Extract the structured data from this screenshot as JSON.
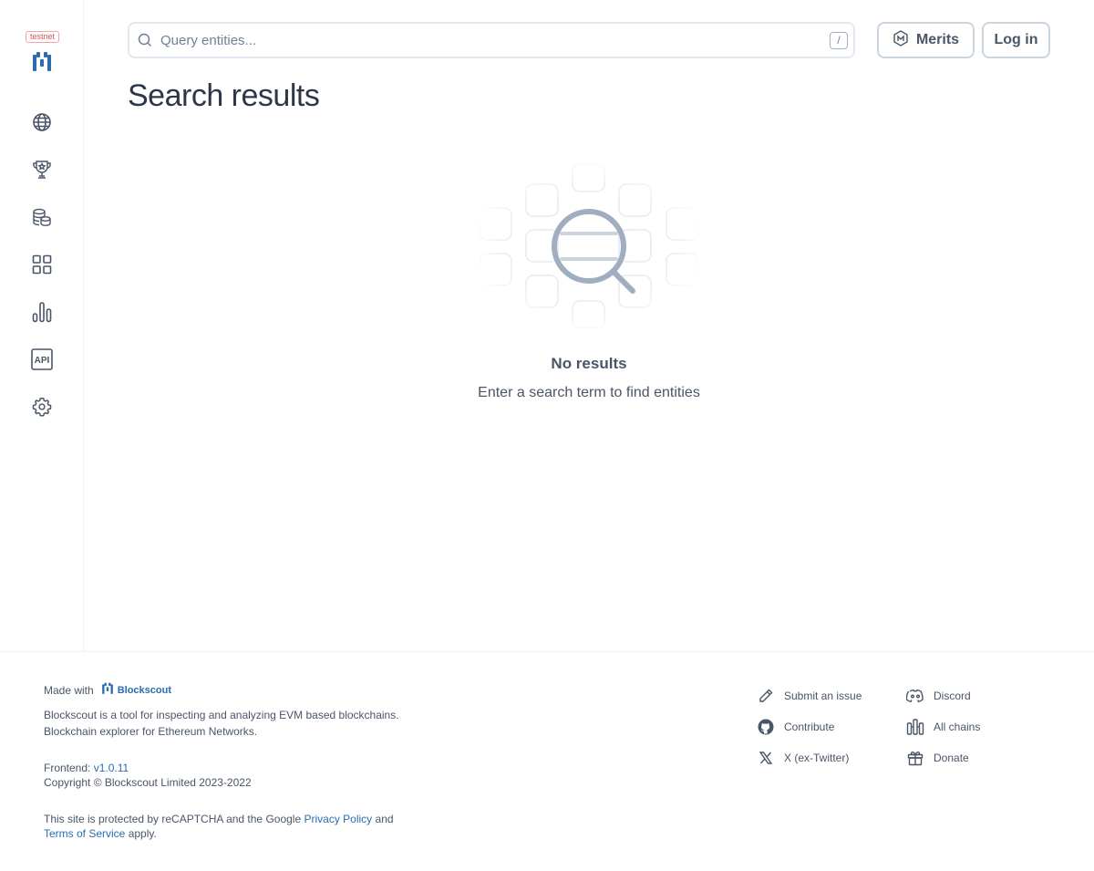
{
  "sidebar": {
    "badge": "testnet",
    "items": [
      {
        "icon": "globe-icon",
        "name": "nav-blockchain"
      },
      {
        "icon": "trophy-icon",
        "name": "nav-rewards"
      },
      {
        "icon": "coins-icon",
        "name": "nav-tokens"
      },
      {
        "icon": "apps-grid-icon",
        "name": "nav-apps"
      },
      {
        "icon": "stats-icon",
        "name": "nav-charts-stats"
      },
      {
        "icon": "api-icon",
        "name": "nav-api"
      },
      {
        "icon": "gear-icon",
        "name": "nav-other"
      }
    ]
  },
  "header": {
    "search_placeholder": "Query entities...",
    "shortcut_key": "/",
    "merits_label": "Merits",
    "login_label": "Log in"
  },
  "main": {
    "title": "Search results",
    "empty_title": "No results",
    "empty_description": "Enter a search term to find entities"
  },
  "footer": {
    "made_with": "Made with",
    "brand_name": "Blockscout",
    "description_1": "Blockscout is a tool for inspecting and analyzing EVM based blockchains.",
    "description_2": "Blockchain explorer for Ethereum Networks.",
    "frontend_label": "Frontend:",
    "frontend_version": "v1.0.11",
    "copyright": "Copyright © Blockscout Limited 2023-2022",
    "recaptcha_prefix": "This site is protected by reCAPTCHA and the Google",
    "privacy_policy": "Privacy Policy",
    "and": "and",
    "terms_of_service": "Terms of Service",
    "apply": "apply.",
    "links": {
      "submit_issue": "Submit an issue",
      "discord": "Discord",
      "contribute": "Contribute",
      "all_chains": "All chains",
      "twitter": "X (ex-Twitter)",
      "donate": "Donate"
    }
  },
  "colors": {
    "link": "#2b6cb0",
    "testnet": "#e05252",
    "icon": "#4a5568"
  }
}
